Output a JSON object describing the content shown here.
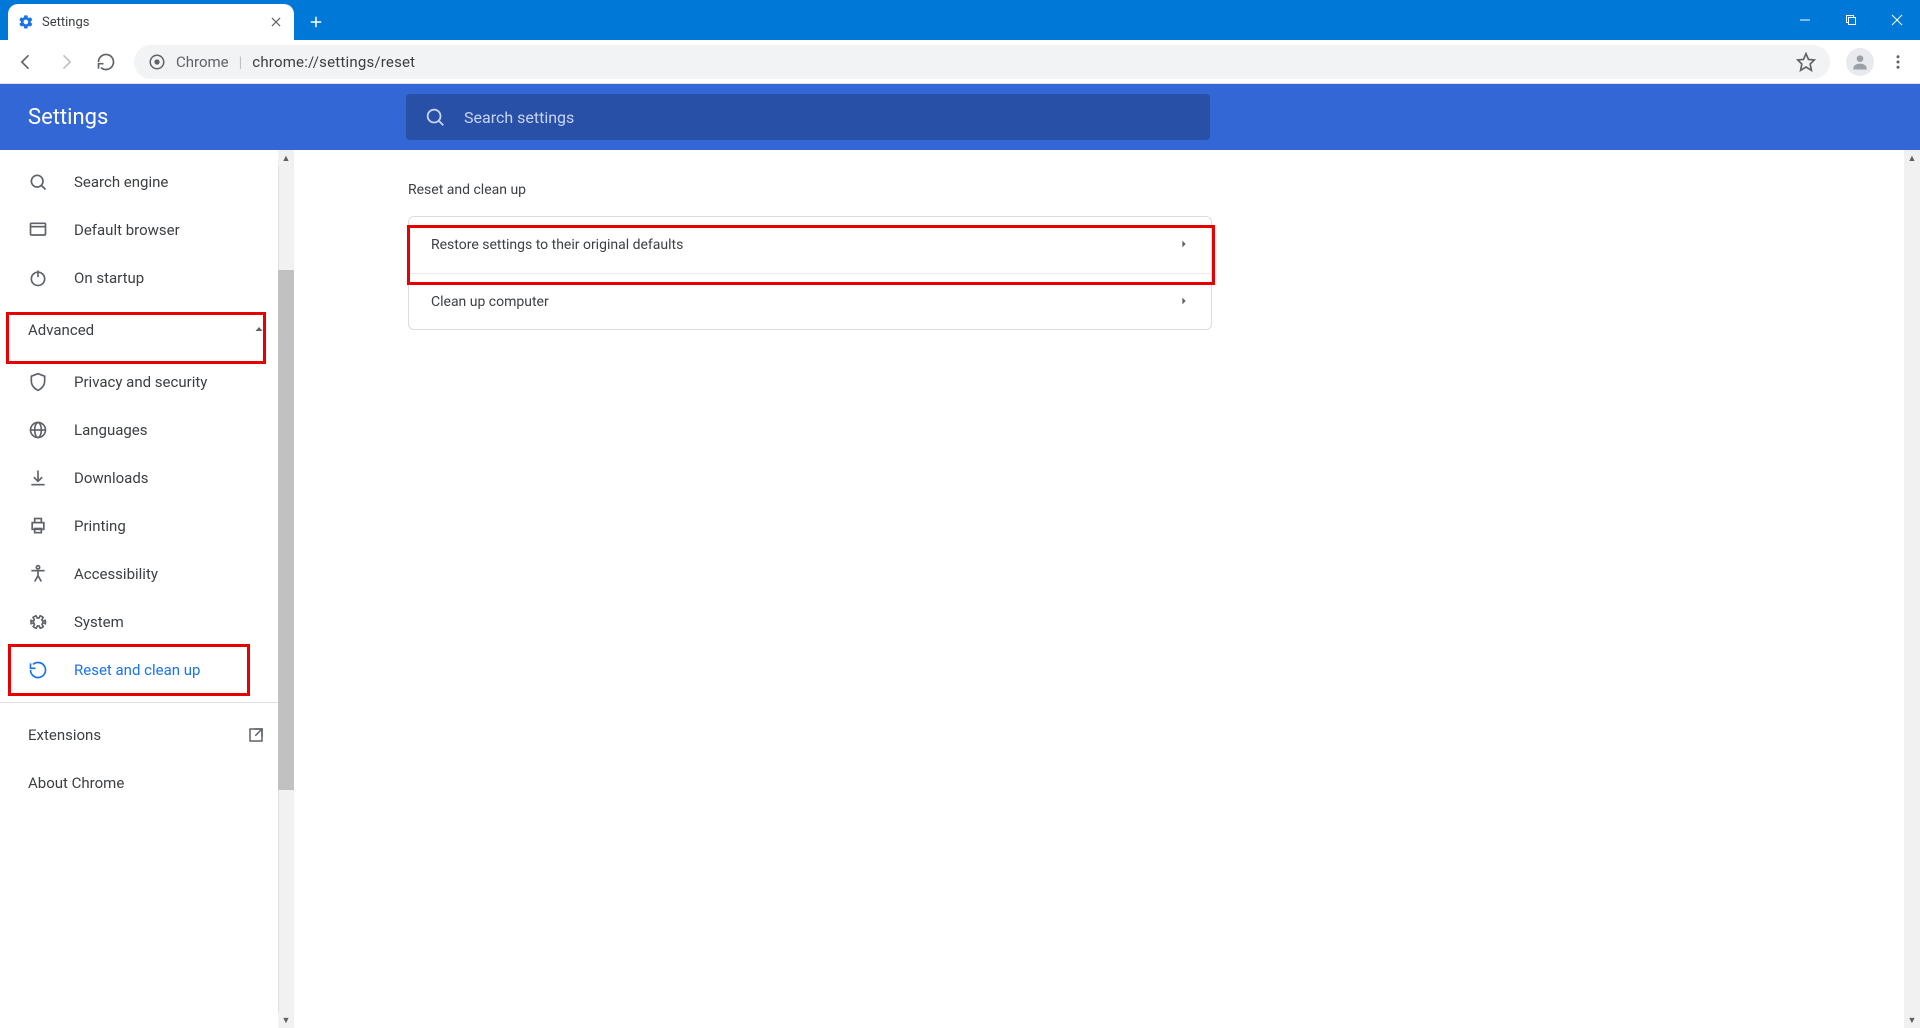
{
  "window": {
    "tab_title": "Settings"
  },
  "omnibox": {
    "label": "Chrome",
    "url": "chrome://settings/reset"
  },
  "header": {
    "title": "Settings",
    "search_placeholder": "Search settings"
  },
  "sidebar": {
    "items_basic": [
      {
        "label": "Search engine"
      },
      {
        "label": "Default browser"
      },
      {
        "label": "On startup"
      }
    ],
    "advanced_label": "Advanced",
    "items_advanced": [
      {
        "label": "Privacy and security"
      },
      {
        "label": "Languages"
      },
      {
        "label": "Downloads"
      },
      {
        "label": "Printing"
      },
      {
        "label": "Accessibility"
      },
      {
        "label": "System"
      },
      {
        "label": "Reset and clean up"
      }
    ],
    "footer": [
      {
        "label": "Extensions"
      },
      {
        "label": "About Chrome"
      }
    ]
  },
  "main": {
    "section_title": "Reset and clean up",
    "rows": [
      {
        "label": "Restore settings to their original defaults"
      },
      {
        "label": "Clean up computer"
      }
    ]
  }
}
